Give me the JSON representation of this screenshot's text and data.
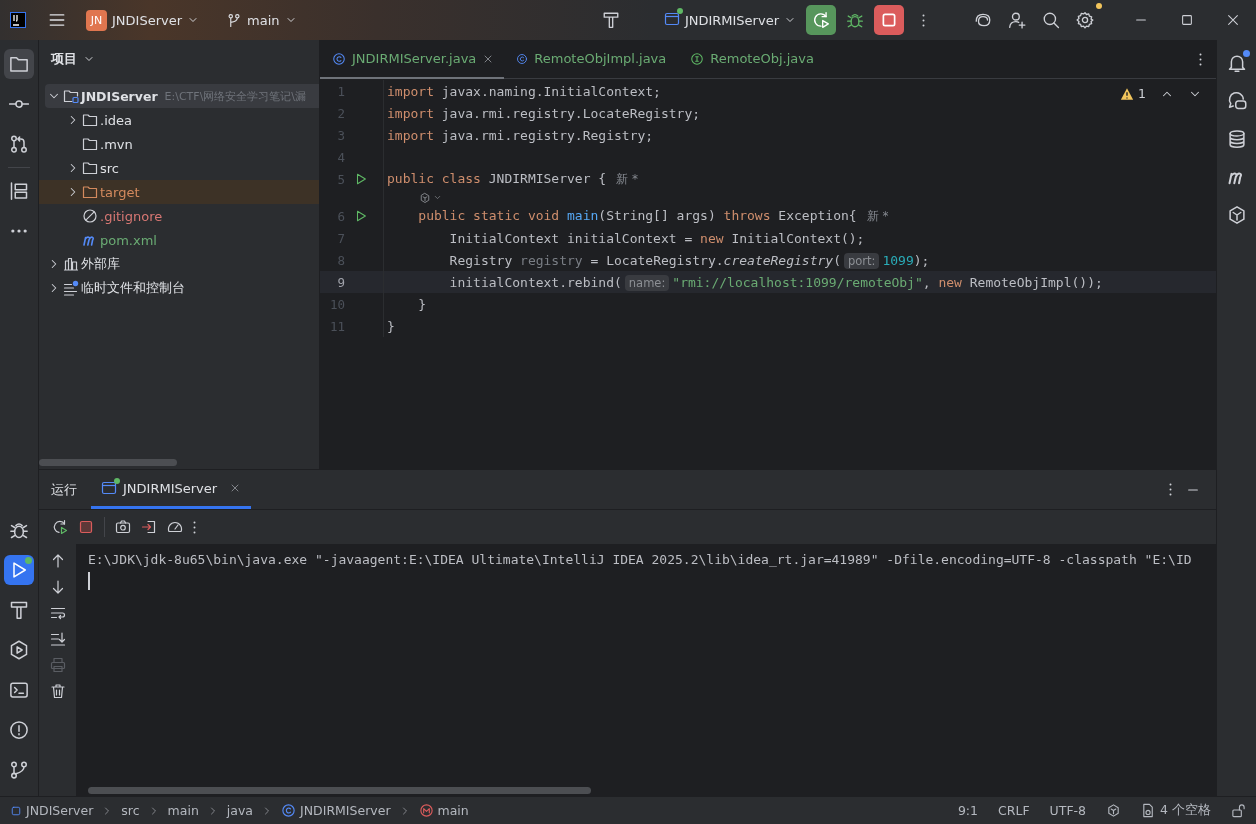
{
  "title_bar": {
    "project_badge": "JN",
    "project": "JNDIServer",
    "branch": "main",
    "run_config": "JNDIRMIServer",
    "running": true
  },
  "left_strip": {
    "top": [
      {
        "kind": "project",
        "selected": true,
        "badge": false
      },
      {
        "kind": "commit",
        "selected": false,
        "badge": false
      },
      {
        "kind": "pull",
        "selected": false,
        "badge": false
      },
      {
        "kind": "structure",
        "selected": false,
        "badge": false
      },
      {
        "kind": "more",
        "selected": false,
        "badge": false
      }
    ],
    "bottom": [
      {
        "kind": "debug",
        "selected": false,
        "badge": false
      },
      {
        "kind": "run",
        "selected": true,
        "badge": true
      },
      {
        "kind": "build",
        "selected": false,
        "badge": false
      },
      {
        "kind": "services",
        "selected": false,
        "badge": false
      },
      {
        "kind": "terminal",
        "selected": false,
        "badge": false
      },
      {
        "kind": "problems",
        "selected": false,
        "badge": false
      },
      {
        "kind": "git",
        "selected": false,
        "badge": false
      }
    ]
  },
  "right_strip": [
    {
      "kind": "notifications",
      "badge": true
    },
    {
      "kind": "aichat",
      "badge": false
    },
    {
      "kind": "database",
      "badge": false
    },
    {
      "kind": "maven",
      "badge": false
    },
    {
      "kind": "ai",
      "badge": false
    }
  ],
  "project_panel": {
    "title": "项目",
    "tree": [
      {
        "label": "JNDIServer",
        "kind": "module",
        "path": "E:\\CTF\\网络安全学习笔记\\漏",
        "expanded": true,
        "selected": true,
        "color": "#dfe1e5",
        "children": [
          {
            "label": ".idea",
            "kind": "folder",
            "expanded": false,
            "selected": false,
            "color": "#dfe1e5"
          },
          {
            "label": ".mvn",
            "kind": "folder",
            "selected": false,
            "color": "#dfe1e5"
          },
          {
            "label": "src",
            "kind": "folder",
            "expanded": false,
            "selected": false,
            "color": "#dfe1e5"
          },
          {
            "label": "target",
            "kind": "excluded",
            "expanded": false,
            "selected": false,
            "color": "#d48a5e"
          },
          {
            "label": ".gitignore",
            "kind": "ignore",
            "selected": false,
            "color": "#d77773"
          },
          {
            "label": "pom.xml",
            "kind": "maven",
            "selected": false,
            "color": "#6aab73"
          }
        ]
      },
      {
        "label": "外部库",
        "kind": "library",
        "expanded": false,
        "selected": false,
        "color": "#dfe1e5"
      },
      {
        "label": "临时文件和控制台",
        "kind": "scratch",
        "expanded": false,
        "selected": false,
        "color": "#dfe1e5"
      }
    ]
  },
  "editor": {
    "tabs": [
      {
        "label": "JNDIRMIServer.java",
        "kind": "class",
        "selected": true,
        "color": "#6aab73"
      },
      {
        "label": "RemoteObjImpl.java",
        "kind": "class",
        "selected": false,
        "color": "#6aab73"
      },
      {
        "label": "RemoteObj.java",
        "kind": "interface",
        "selected": false,
        "color": "#6aab73"
      }
    ],
    "warnings": "1",
    "lines": [
      {
        "kind": "code",
        "number": "1",
        "run": false,
        "selected": false,
        "segments": [
          {
            "kind": "kw",
            "text": "import"
          },
          {
            "kind": "plain",
            "text": " javax.naming.InitialContext;"
          }
        ]
      },
      {
        "kind": "code",
        "number": "2",
        "run": false,
        "selected": false,
        "segments": [
          {
            "kind": "kw",
            "text": "import"
          },
          {
            "kind": "plain",
            "text": " java.rmi.registry.LocateRegistry;"
          }
        ]
      },
      {
        "kind": "code",
        "number": "3",
        "run": false,
        "selected": false,
        "segments": [
          {
            "kind": "kw",
            "text": "import"
          },
          {
            "kind": "plain",
            "text": " java.rmi.registry.Registry;"
          }
        ]
      },
      {
        "kind": "code",
        "number": "4",
        "run": false,
        "selected": false
      },
      {
        "kind": "code",
        "number": "5",
        "run": true,
        "selected": false,
        "segments": [
          {
            "kind": "kw",
            "text": "public class"
          },
          {
            "kind": "plain",
            "text": " JNDIRMIServer {"
          },
          {
            "kind": "hint",
            "text": "新 *"
          }
        ]
      },
      {
        "kind": "lens"
      },
      {
        "kind": "code",
        "number": "6",
        "run": true,
        "selected": false,
        "segments": [
          {
            "kind": "kw",
            "text": "    public static void "
          },
          {
            "kind": "decl",
            "text": "main"
          },
          {
            "kind": "plain",
            "text": "(String[] args) "
          },
          {
            "kind": "kw",
            "text": "throws"
          },
          {
            "kind": "plain",
            "text": " Exception{"
          },
          {
            "kind": "hint",
            "text": "新 *"
          }
        ]
      },
      {
        "kind": "code",
        "number": "7",
        "run": false,
        "selected": false,
        "segments": [
          {
            "kind": "plain",
            "text": "        InitialContext initialContext = "
          },
          {
            "kind": "kw",
            "text": "new"
          },
          {
            "kind": "plain",
            "text": " InitialContext();"
          }
        ]
      },
      {
        "kind": "code",
        "number": "8",
        "run": false,
        "selected": false,
        "segments": [
          {
            "kind": "plain",
            "text": "        Registry "
          },
          {
            "kind": "unused",
            "text": "registry"
          },
          {
            "kind": "plain",
            "text": " = LocateRegistry."
          },
          {
            "kind": "call",
            "text": "createRegistry"
          },
          {
            "kind": "plain",
            "text": "("
          },
          {
            "kind": "param",
            "text": "port:"
          },
          {
            "kind": "num",
            "text": "1099"
          },
          {
            "kind": "plain",
            "text": ");"
          }
        ]
      },
      {
        "kind": "code",
        "number": "9",
        "run": false,
        "selected": true,
        "segments": [
          {
            "kind": "plain",
            "text": "        initialContext.rebind("
          },
          {
            "kind": "param",
            "text": "name:"
          },
          {
            "kind": "str",
            "text": "\"rmi://localhost:1099/remoteObj\""
          },
          {
            "kind": "plain",
            "text": ", "
          },
          {
            "kind": "kw",
            "text": "new"
          },
          {
            "kind": "plain",
            "text": " RemoteObjImpl());"
          }
        ]
      },
      {
        "kind": "code",
        "number": "10",
        "run": false,
        "selected": false,
        "segments": [
          {
            "kind": "plain",
            "text": "    }"
          }
        ]
      },
      {
        "kind": "code",
        "number": "11",
        "run": false,
        "selected": false,
        "segments": [
          {
            "kind": "plain",
            "text": "}"
          }
        ]
      }
    ]
  },
  "run_panel": {
    "title": "运行",
    "tabs": [
      {
        "label": "JNDIRMIServer",
        "selected": true
      }
    ],
    "console": [
      "E:\\JDK\\jdk-8u65\\bin\\java.exe \"-javaagent:E:\\IDEA Ultimate\\IntelliJ IDEA 2025.2\\lib\\idea_rt.jar=41989\" -Dfile.encoding=UTF-8 -classpath \"E:\\ID"
    ]
  },
  "status_bar": {
    "breadcrumbs": [
      {
        "label": "JNDIServer",
        "kind": "module"
      },
      {
        "label": "src",
        "kind": "folder"
      },
      {
        "label": "main",
        "kind": "folder"
      },
      {
        "label": "java",
        "kind": "folder"
      },
      {
        "label": "JNDIRMIServer",
        "kind": "class"
      },
      {
        "label": "main",
        "kind": "method"
      }
    ],
    "position": "9:1",
    "line_separator": "CRLF",
    "encoding": "UTF-8",
    "indent": "4 个空格"
  }
}
